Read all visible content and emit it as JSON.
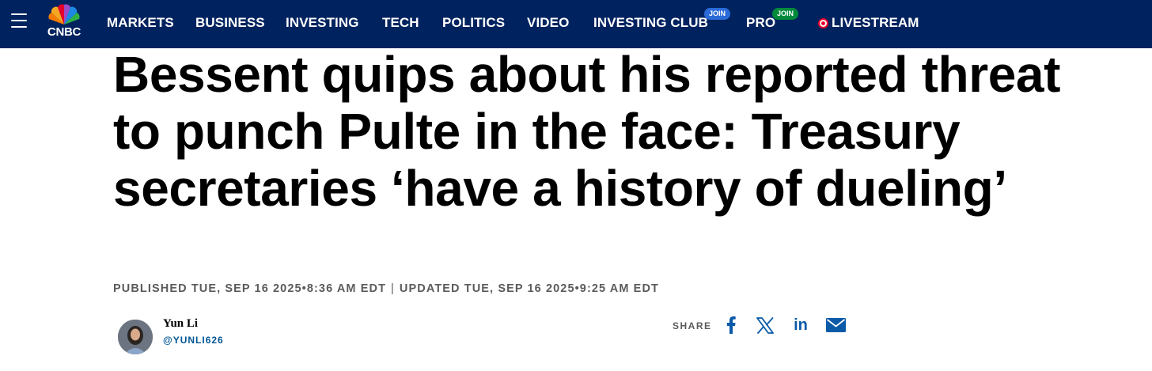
{
  "brand": {
    "name": "CNBC"
  },
  "nav": {
    "items": [
      "MARKETS",
      "BUSINESS",
      "INVESTING",
      "TECH",
      "POLITICS",
      "VIDEO",
      "INVESTING CLUB",
      "PRO",
      "LIVESTREAM"
    ],
    "investing_club_badge": "JOIN",
    "pro_badge": "JOIN"
  },
  "colors": {
    "nav_bg": "#00235f",
    "join_blue": "#2a6bd8",
    "join_green": "#008a3c",
    "live_red": "#e4002b",
    "link_blue": "#005594"
  },
  "article": {
    "headline": "Bessent quips about his reported threat to punch Pulte in the face: Treasury secretaries ‘have a history of dueling’",
    "published": "PUBLISHED TUE, SEP 16 2025•8:36 AM EDT",
    "separator": "|",
    "updated": "UPDATED TUE, SEP 16 2025•9:25 AM EDT"
  },
  "author": {
    "name": "Yun Li",
    "handle": "@YUNLI626"
  },
  "share": {
    "label": "SHARE",
    "icons": [
      "facebook-icon",
      "x-icon",
      "linkedin-icon",
      "email-icon"
    ],
    "linkedin_glyph": "in"
  }
}
